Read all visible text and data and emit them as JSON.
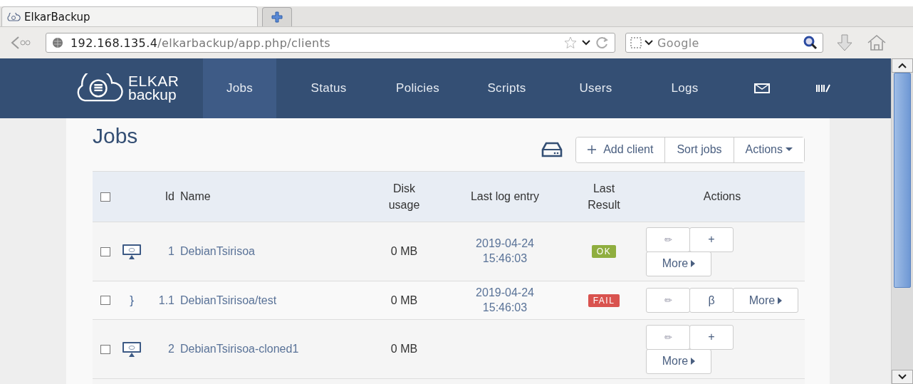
{
  "browser": {
    "tab": {
      "title": "ElkarBackup",
      "selected": true
    },
    "address": {
      "host": "192.168.135.4",
      "path": "/elkarbackup/app.php/clients"
    },
    "search": {
      "placeholder": "Google"
    }
  },
  "navbar": {
    "logo": {
      "top": "ELKAR",
      "bottom": "backup"
    },
    "items": [
      {
        "label": "Jobs",
        "selected": true
      },
      {
        "label": "Status",
        "selected": false
      },
      {
        "label": "Policies",
        "selected": false
      },
      {
        "label": "Scripts",
        "selected": false
      },
      {
        "label": "Users",
        "selected": false
      },
      {
        "label": "Logs",
        "selected": false
      }
    ]
  },
  "page": {
    "title": "Jobs",
    "toolbar": [
      {
        "label": "Add client",
        "kind": "add"
      },
      {
        "label": "Sort jobs",
        "kind": "plain"
      },
      {
        "label": "Actions",
        "kind": "dropdown"
      }
    ]
  },
  "table": {
    "columns": [
      "Id",
      "Name",
      "Disk usage",
      "Last log entry",
      "Last Result",
      "Actions"
    ],
    "header_checked": false,
    "rows": [
      {
        "kind": "client",
        "checked": false,
        "id": "1",
        "name": "DebianTsirisoa",
        "disk": "0 MB",
        "log_date": "2019-04-24",
        "log_time": "15:46:03",
        "result": {
          "label": "OK",
          "kind": "ok"
        },
        "actions": [
          "✏",
          "+",
          "More"
        ]
      },
      {
        "kind": "job",
        "marker": "}",
        "checked": false,
        "id": "1.1",
        "name": "DebianTsirisoa/test",
        "disk": "0 MB",
        "log_date": "2019-04-24",
        "log_time": "15:46:03",
        "result": {
          "label": "FAIL",
          "kind": "fail"
        },
        "actions": [
          "✏",
          "β",
          "More"
        ]
      },
      {
        "kind": "client",
        "checked": false,
        "id": "2",
        "name": "DebianTsirisoa-cloned1",
        "disk": "0 MB",
        "actions": [
          "✏",
          "+",
          "More"
        ]
      }
    ]
  }
}
